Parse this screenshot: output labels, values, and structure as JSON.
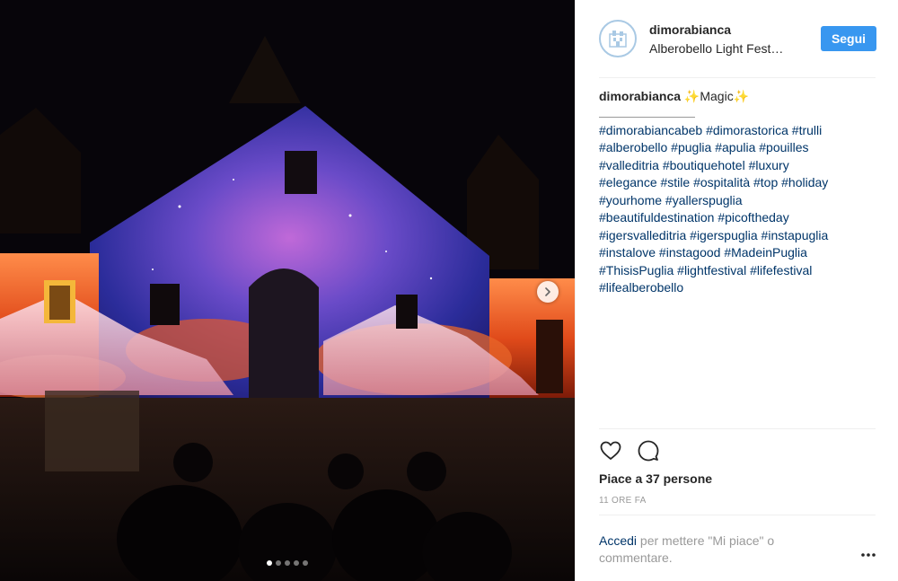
{
  "post": {
    "username": "dimorabianca",
    "location": "Alberobello Light Fest…",
    "follow_label": "Segui",
    "caption_text": "✨Magic✨",
    "hashtag_lines": [
      "#dimorabiancabeb #dimorastorica #trulli",
      "#alberobello #puglia #apulia #pouilles",
      "#valleditria #boutiquehotel #luxury",
      "#elegance #stile #ospitalità #top #holiday",
      "#yourhome #yallerspuglia",
      "#beautifuldestination #picoftheday",
      "#igersvalleditria #igerspuglia #instapuglia",
      "#instalove #instagood #MadeinPuglia",
      "#ThisisPuglia #lightfestival #lifefestival",
      "#lifealberobello"
    ],
    "likes_text": "Piace a 37 persone",
    "time_text": "11 ORE FA",
    "login_link": "Accedi",
    "login_text": " per mettere \"Mi piace\" o commentare."
  },
  "carousel": {
    "count": 5,
    "active_index": 0
  },
  "icons": {
    "like": "heart-icon",
    "comment": "comment-icon",
    "next": "chevron-right-icon",
    "more": "more-options-icon",
    "avatar": "building-logo-icon"
  },
  "colors": {
    "accent": "#3897f0",
    "link": "#003569",
    "muted": "#999999",
    "text": "#262626"
  }
}
